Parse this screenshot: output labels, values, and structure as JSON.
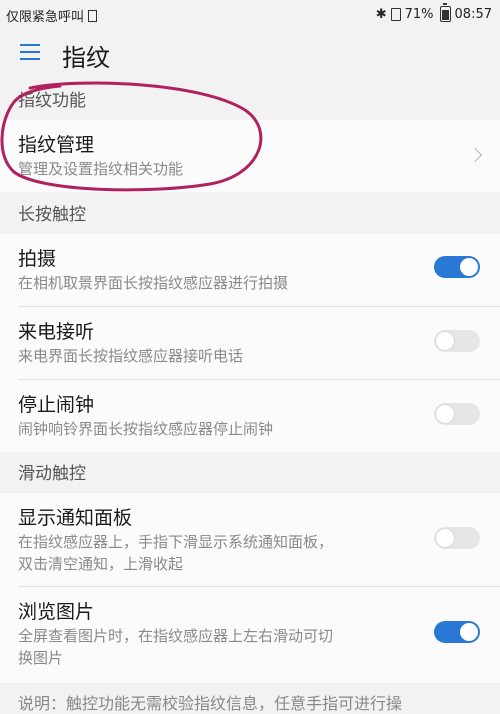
{
  "status_bar": {
    "carrier": "仅限紧急呼叫",
    "battery": "71%",
    "time": "08:57"
  },
  "app_bar": {
    "title": "指纹"
  },
  "sections": {
    "fingerprint_functions": {
      "header": "指纹功能",
      "management": {
        "title": "指纹管理",
        "subtitle": "管理及设置指纹相关功能"
      }
    },
    "long_press": {
      "header": "长按触控",
      "items": [
        {
          "title": "拍摄",
          "subtitle": "在相机取景界面长按指纹感应器进行拍摄",
          "enabled": true
        },
        {
          "title": "来电接听",
          "subtitle": "来电界面长按指纹感应器接听电话",
          "enabled": false
        },
        {
          "title": "停止闹钟",
          "subtitle": "闹钟响铃界面长按指纹感应器停止闹钟",
          "enabled": false
        }
      ]
    },
    "slide": {
      "header": "滑动触控",
      "items": [
        {
          "title": "显示通知面板",
          "subtitle_line1": "在指纹感应器上，手指下滑显示系统通知面板，",
          "subtitle_line2": "双击清空通知，上滑收起",
          "enabled": false
        },
        {
          "title": "浏览图片",
          "subtitle_line1": "全屏查看图片时，在指纹感应器上左右滑动可切",
          "subtitle_line2": "换图片",
          "enabled": true
        }
      ]
    }
  },
  "footer_note": "说明：触控功能无需校验指纹信息，任意手指可进行操",
  "colors": {
    "accent": "#2a78d6",
    "annotation": "#b0215e",
    "background": "#f2f2f2"
  }
}
